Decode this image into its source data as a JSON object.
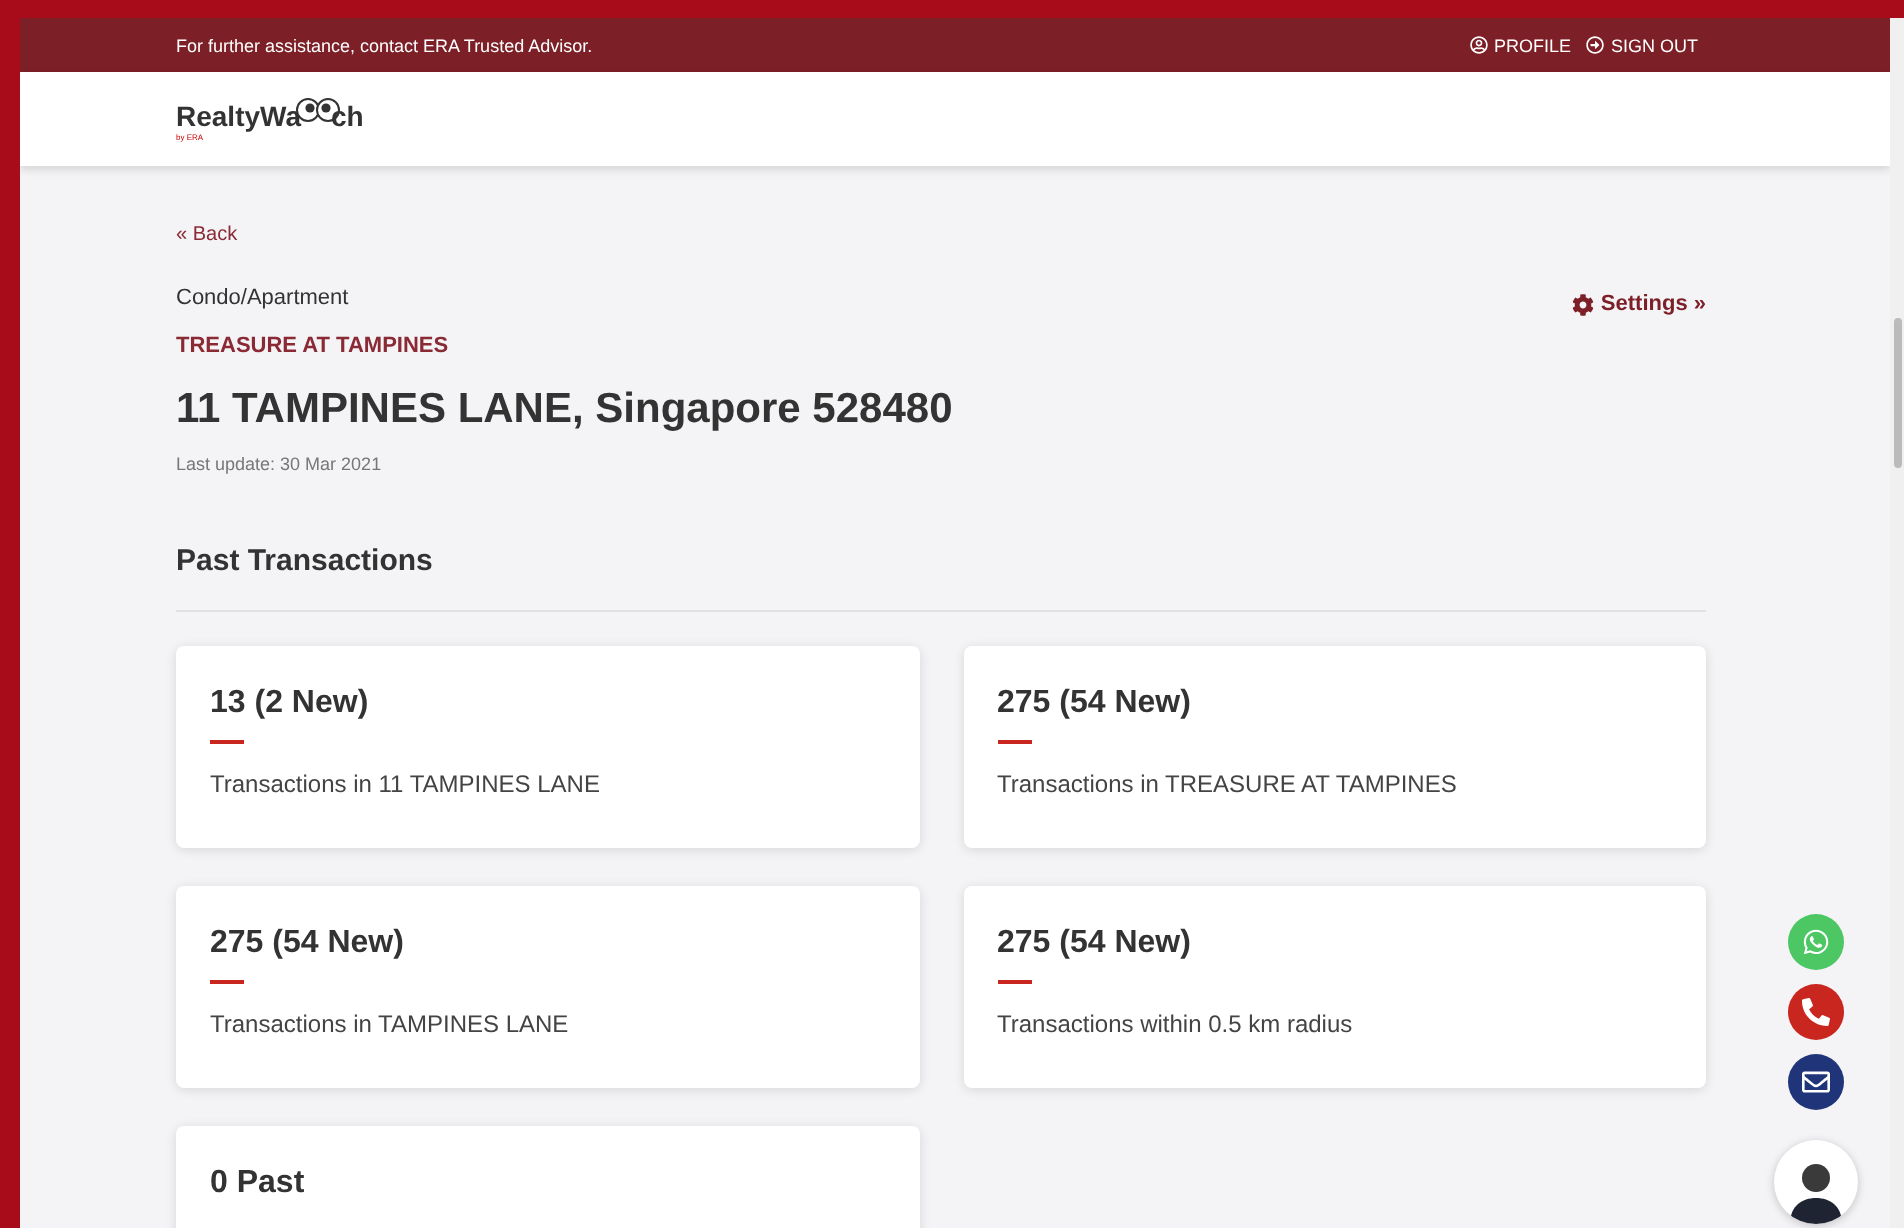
{
  "top_bar": {
    "message": "For further assistance, contact ERA Trusted Advisor.",
    "links": [
      {
        "label": "PROFILE",
        "kind": "profile"
      },
      {
        "label": "SIGN OUT",
        "kind": "signout"
      }
    ]
  },
  "header": {
    "logo_text": "RealtyWa",
    "logo_suffix": "ch",
    "logo_sub": "by ERA"
  },
  "back_link": "« Back",
  "property_type": "Condo/Apartment",
  "settings_link": "Settings »",
  "project_name": "TREASURE AT TAMPINES",
  "address": "11 TAMPINES LANE, Singapore 528480",
  "last_update": "Last update: 30 Mar 2021",
  "section_title": "Past Transactions",
  "cards": [
    {
      "count": "13 (2 New)",
      "label": "Transactions in 11 TAMPINES LANE"
    },
    {
      "count": "275 (54 New)",
      "label": "Transactions in TREASURE AT TAMPINES"
    },
    {
      "count": "275 (54 New)",
      "label": "Transactions in TAMPINES LANE"
    },
    {
      "count": "275 (54 New)",
      "label": "Transactions within 0.5 km radius"
    },
    {
      "count": "0 Past"
    }
  ],
  "contact_buttons": [
    {
      "kind": "whatsapp",
      "color": "#4cc764"
    },
    {
      "kind": "phone",
      "color": "#c8261f"
    },
    {
      "kind": "email",
      "color": "#1f3479"
    }
  ]
}
